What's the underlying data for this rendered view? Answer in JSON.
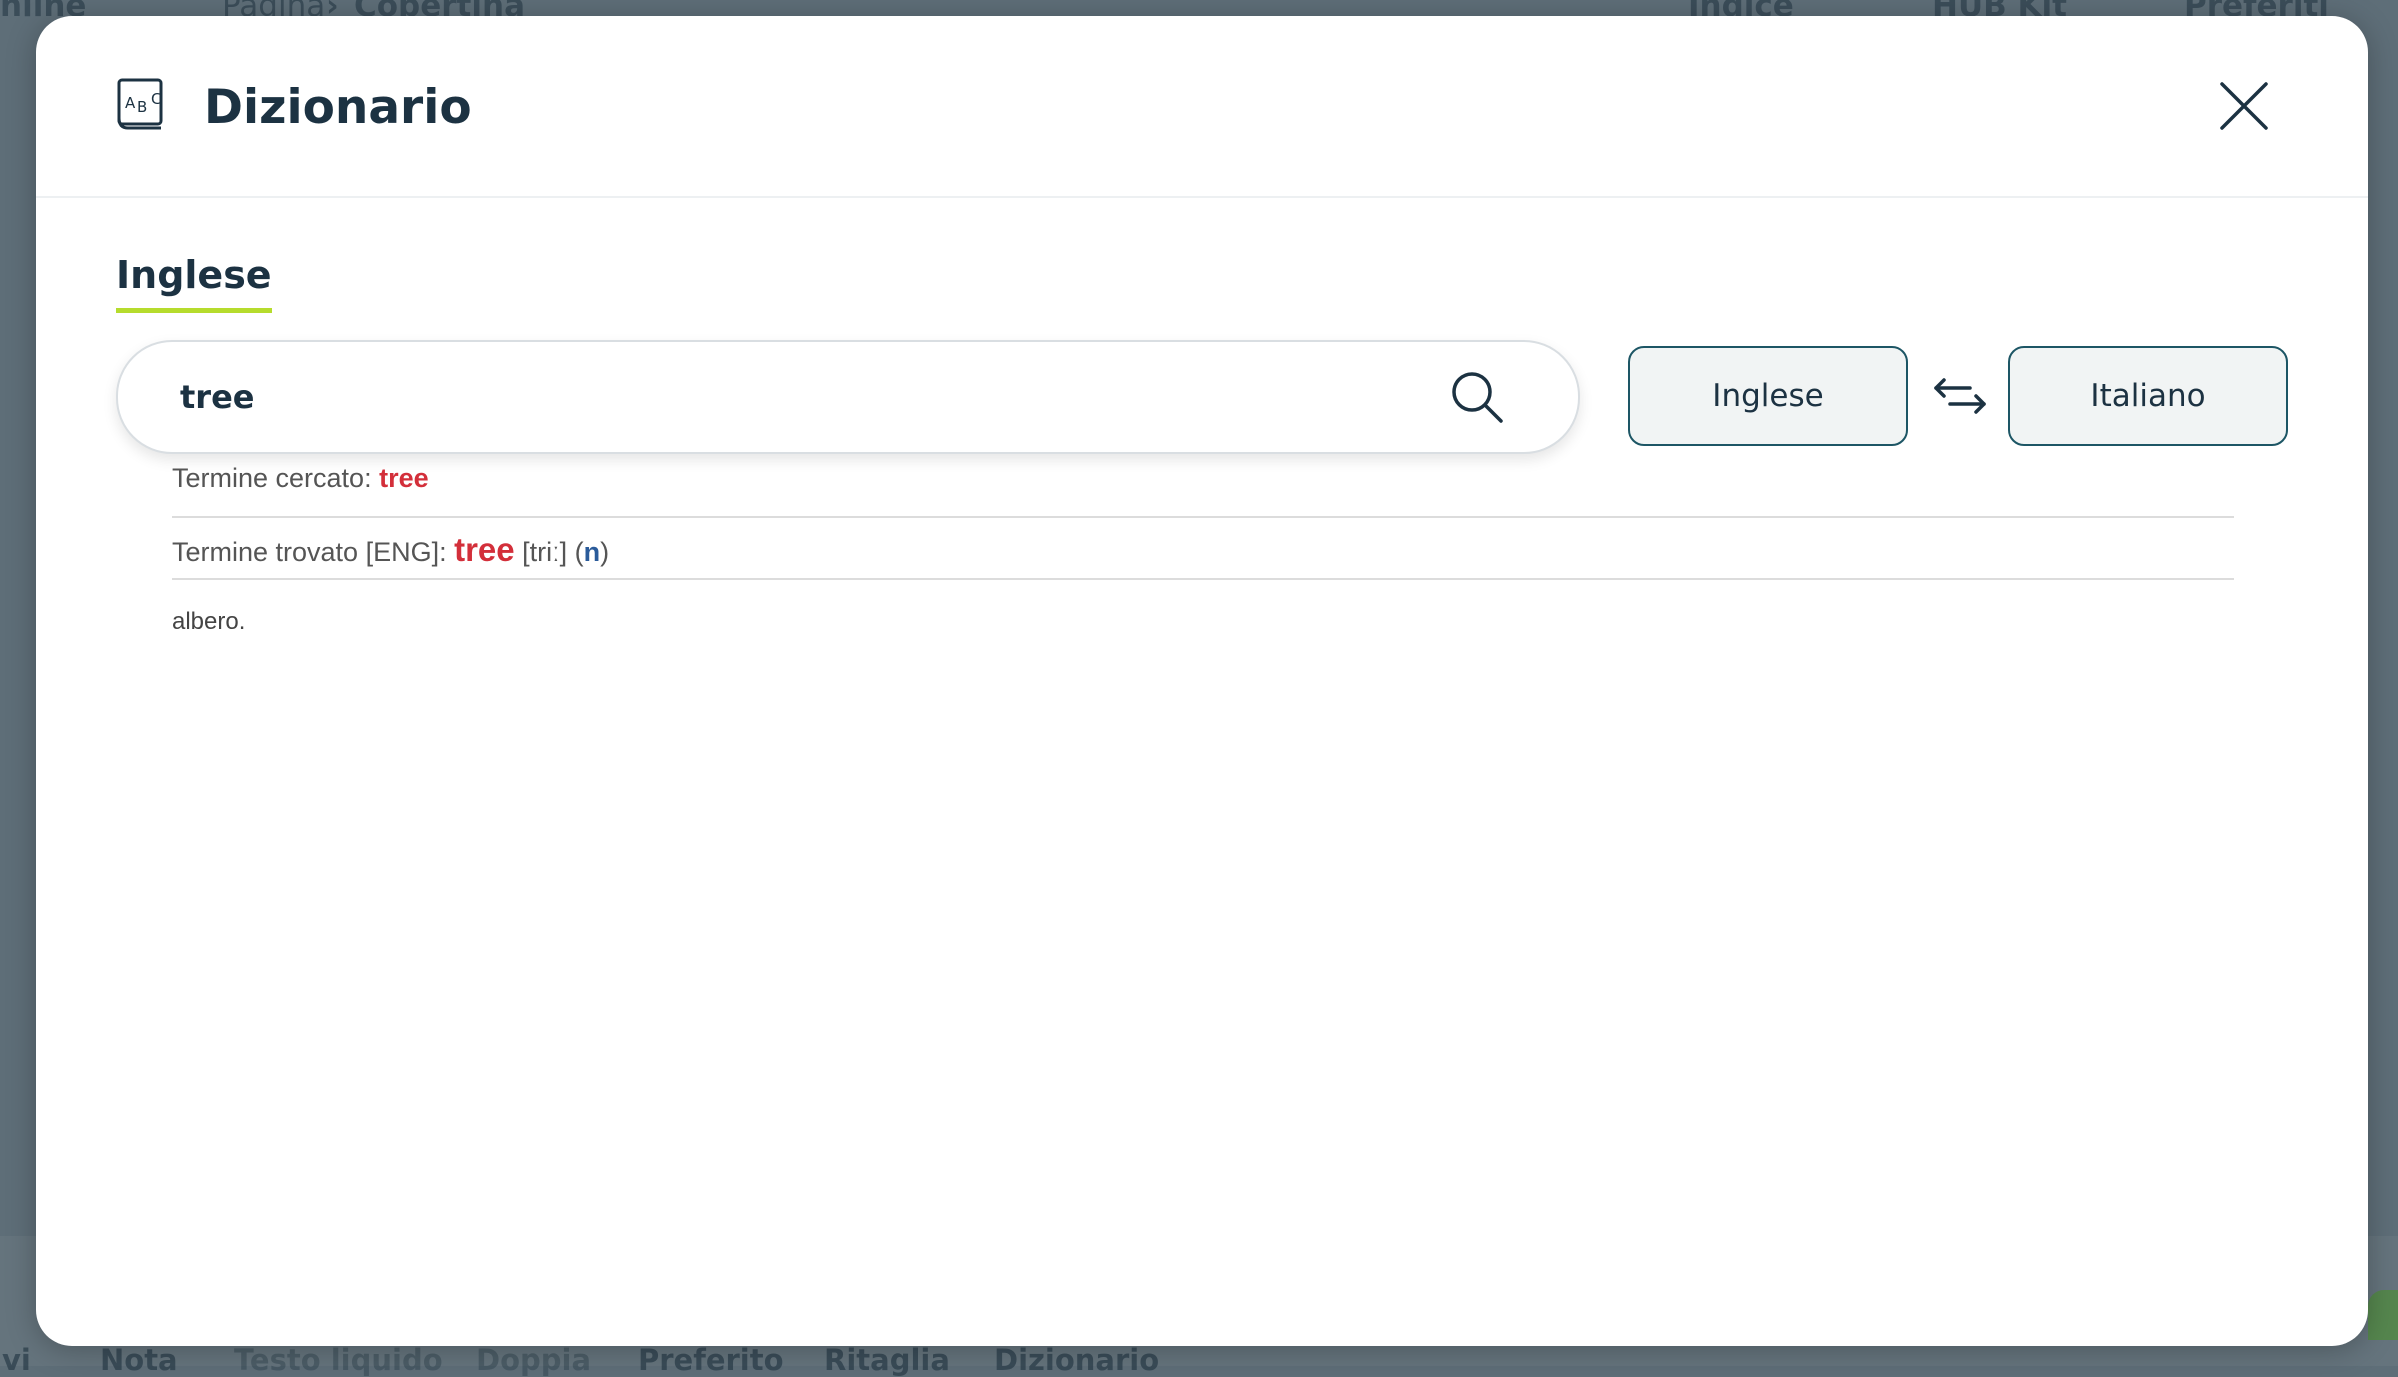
{
  "background": {
    "top_left": "nline",
    "breadcrumb_page": "Pagina",
    "breadcrumb_sep": "›",
    "breadcrumb_current": "Copertina",
    "index_label": "Indice",
    "hub_label": "HUB Kit",
    "favorites_label": "Preferiti",
    "bottom_tabs": [
      "ivi",
      "Nota",
      "Testo liquido",
      "Doppia",
      "Preferito",
      "Ritaglia",
      "Dizionario"
    ]
  },
  "modal": {
    "title": "Dizionario",
    "icon": "dictionary-abc-icon",
    "close_icon": "close-icon",
    "active_tab": "Inglese",
    "search": {
      "value": "tree",
      "icon": "search-icon"
    },
    "source_lang": "Inglese",
    "target_lang": "Italiano",
    "swap_icon": "swap-arrows-icon"
  },
  "result": {
    "searched_label": "Termine cercato: ",
    "searched_term": "tree",
    "found_label": "Termine trovato [ENG]: ",
    "found_term": "tree",
    "pronunciation": " [triː] (",
    "part_of_speech": "n",
    "pos_close": ")",
    "definition": "albero."
  },
  "colors": {
    "accent_underline": "#b6dc2d",
    "highlight_red": "#d32f3a",
    "button_border": "#1d5665",
    "title_text": "#1c3242"
  }
}
